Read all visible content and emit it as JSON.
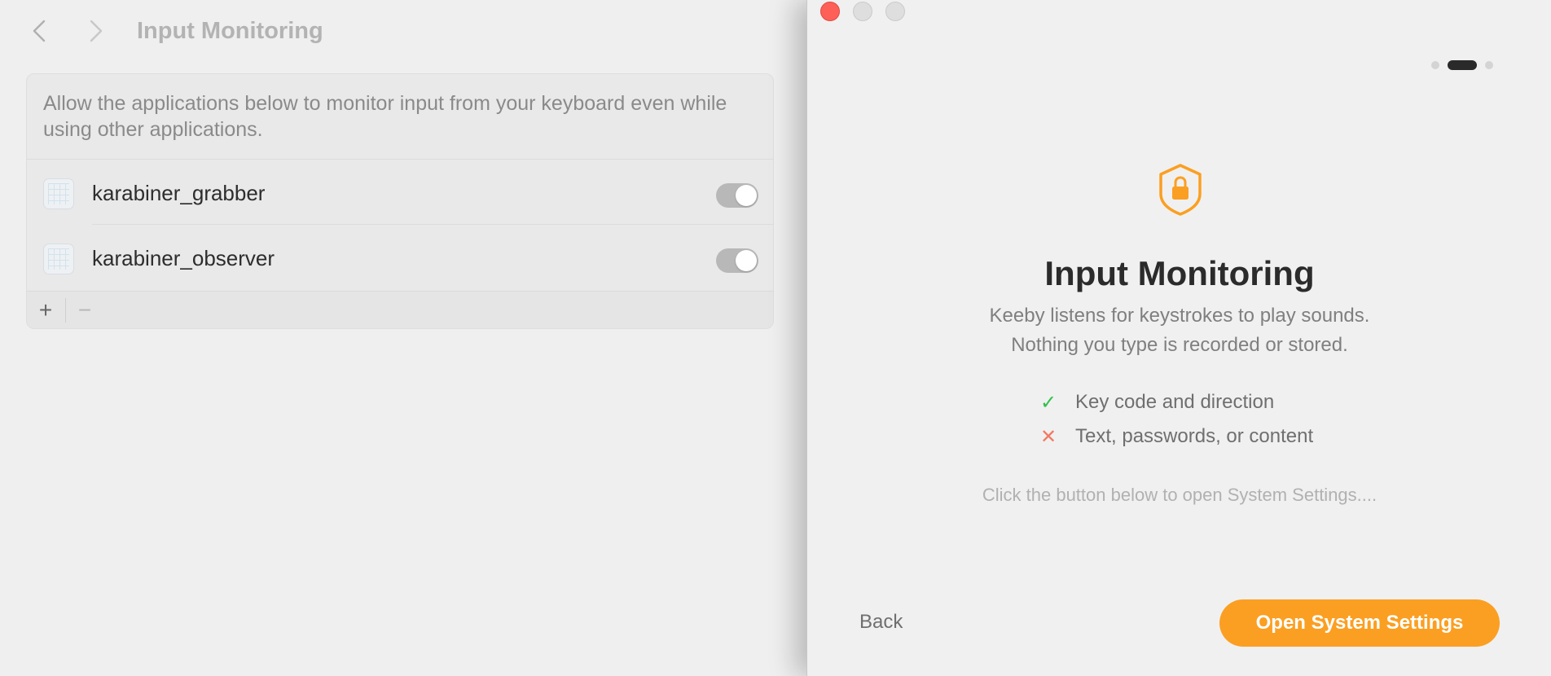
{
  "settings": {
    "title": "Input Monitoring",
    "description": "Allow the applications below to monitor input from your keyboard even while using other applications.",
    "apps": [
      {
        "name": "karabiner_grabber",
        "enabled": true
      },
      {
        "name": "karabiner_observer",
        "enabled": true
      }
    ],
    "add_label": "+",
    "remove_label": "−"
  },
  "onboarding": {
    "title": "Input Monitoring",
    "subtitle_line1": "Keeby listens for keystrokes to play sounds.",
    "subtitle_line2": "Nothing you type is recorded or stored.",
    "bullets": [
      {
        "icon": "check-icon",
        "mark": "✓",
        "text": "Key code and direction"
      },
      {
        "icon": "cross-icon",
        "mark": "✕",
        "text": "Text, passwords, or content"
      }
    ],
    "hint": "Click the button below to open System Settings....",
    "back_label": "Back",
    "primary_label": "Open System Settings",
    "step_current": 2,
    "step_total": 3
  },
  "colors": {
    "accent": "#fb9f22",
    "check": "#30c04a",
    "cross": "#f07a62",
    "close": "#fe5f57"
  }
}
